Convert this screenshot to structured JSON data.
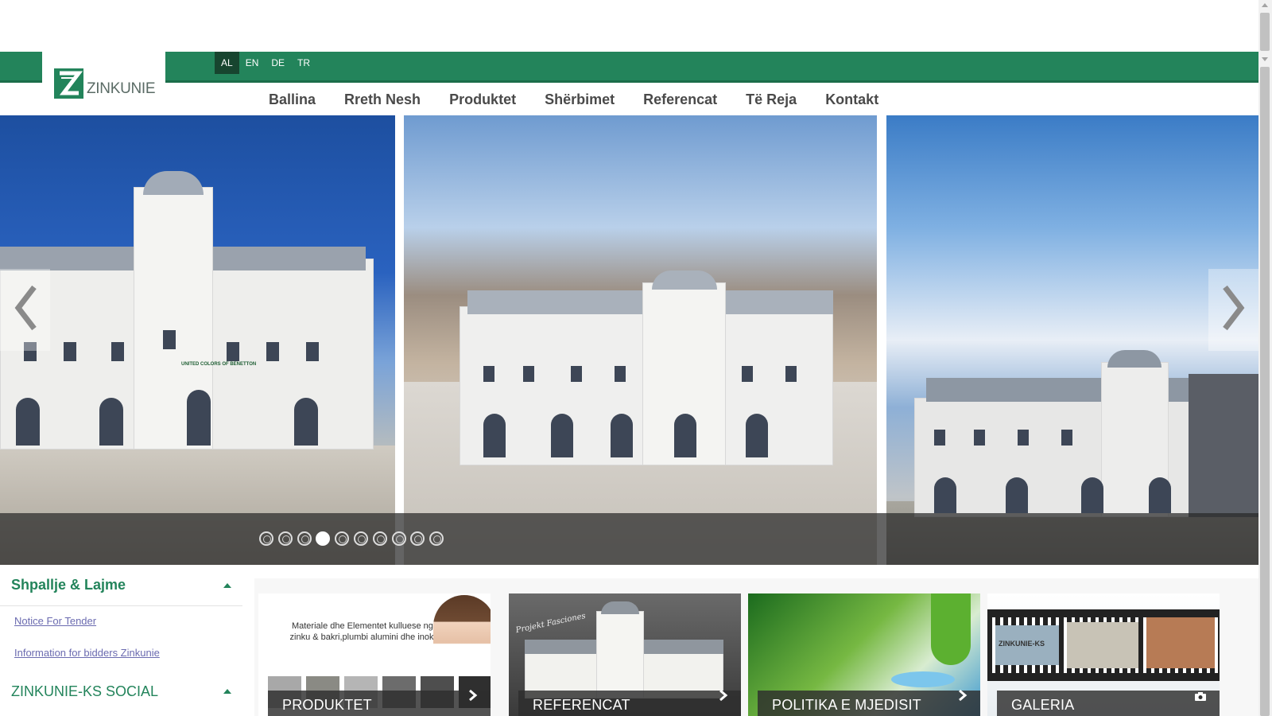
{
  "brand": {
    "name": "ZINKUNIE",
    "accent": "#23845b",
    "dark": "#17452f"
  },
  "languages": [
    {
      "code": "AL",
      "active": true
    },
    {
      "code": "EN",
      "active": false
    },
    {
      "code": "DE",
      "active": false
    },
    {
      "code": "TR",
      "active": false
    }
  ],
  "nav": [
    "Ballina",
    "Rreth Nesh",
    "Produktet",
    "Shërbimet",
    "Referencat",
    "Të Reja",
    "Kontakt"
  ],
  "slider": {
    "slide_count": 10,
    "active_index": 4,
    "prev_icon": "chevron-left-icon",
    "next_icon": "chevron-right-icon",
    "storefront_sign": "UNITED COLORS OF BENETTON"
  },
  "sidebar": {
    "news": {
      "title": "Shpallje & Lajme",
      "links": [
        "Notice For Tender",
        "Information for bidders Zinkunie"
      ]
    },
    "social": {
      "title": "ZINKUNIE-KS SOCIAL"
    }
  },
  "tiles": [
    {
      "label": "PRODUKTET",
      "icon": "chevron-right-icon",
      "text": "Materiale dhe Elementet kulluese nga zinku & bakri,plumbi alumini dhe inoksi"
    },
    {
      "label": "REFERENCAT",
      "icon": "chevron-right-icon",
      "text": "Projekt Fasciones"
    },
    {
      "label": "POLITIKA E MJEDISIT",
      "icon": "chevron-right-icon"
    },
    {
      "label": "GALERIA",
      "icon": "camera-icon",
      "text": "ZINKUNIE-KS"
    }
  ]
}
